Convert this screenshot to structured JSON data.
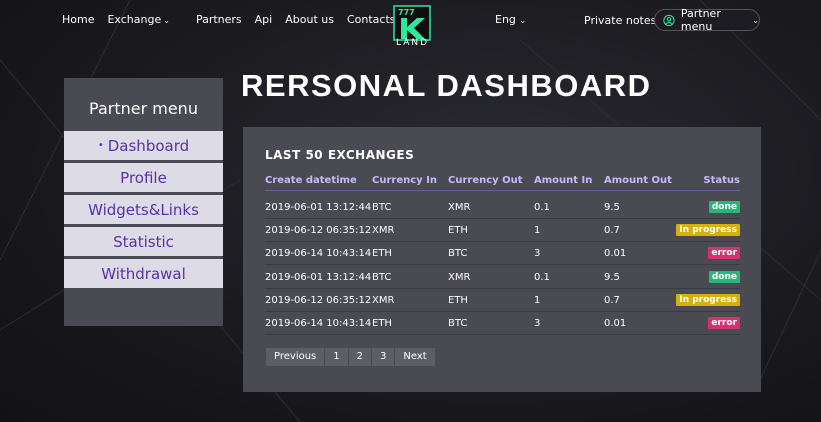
{
  "nav": {
    "links": [
      "Home",
      "Exchange",
      "Partners",
      "Api",
      "About us",
      "Contacts"
    ],
    "lang": "Eng",
    "private_notes": "Private notes",
    "partner_menu": "Partner menu",
    "logo_text": "LAND",
    "logo_digits": "777"
  },
  "sidebar": {
    "title": "Partner menu",
    "items": [
      "Dashboard",
      "Profile",
      "Widgets&Links",
      "Statistic",
      "Withdrawal"
    ]
  },
  "page_title": "RERSONAL DASHBOARD",
  "table": {
    "title": "LAST 50 EXCHANGES",
    "headers": [
      "Create datetime",
      "Currency In",
      "Currency Out",
      "Amount In",
      "Amount Out",
      "Status"
    ],
    "rows": [
      [
        "2019-06-01 13:12:44",
        "BTC",
        "XMR",
        "0.1",
        "9.5",
        "done"
      ],
      [
        "2019-06-12 06:35:12",
        "XMR",
        "ETH",
        "1",
        "0.7",
        "In progress"
      ],
      [
        "2019-06-14 10:43:14",
        "ETH",
        "BTC",
        "3",
        "0.01",
        "error"
      ],
      [
        "2019-06-01 13:12:44",
        "BTC",
        "XMR",
        "0.1",
        "9.5",
        "done"
      ],
      [
        "2019-06-12 06:35:12",
        "XMR",
        "ETH",
        "1",
        "0.7",
        "In progress"
      ],
      [
        "2019-06-14 10:43:14",
        "ETH",
        "BTC",
        "3",
        "0.01",
        "error"
      ]
    ]
  },
  "pager": [
    "Previous",
    "1",
    "2",
    "3",
    "Next"
  ],
  "colors": {
    "accent": "#5a31a8",
    "done": "#2bb57a",
    "progress": "#d4b20c",
    "error": "#d6326e",
    "logo": "#2ee89a"
  }
}
